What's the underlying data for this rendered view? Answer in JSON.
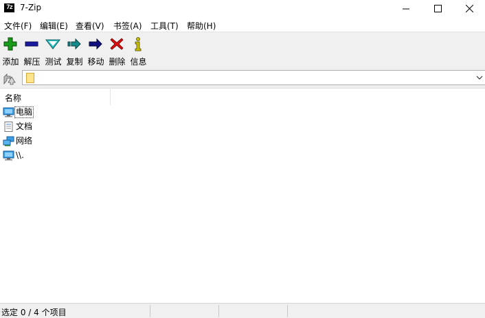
{
  "window": {
    "app_icon": "7z",
    "title": "7-Zip"
  },
  "menu": [
    "文件(F)",
    "编辑(E)",
    "查看(V)",
    "书签(A)",
    "工具(T)",
    "帮助(H)"
  ],
  "toolbar": [
    {
      "label": "添加",
      "icon": "add-icon"
    },
    {
      "label": "解压",
      "icon": "extract-icon"
    },
    {
      "label": "测试",
      "icon": "test-icon"
    },
    {
      "label": "复制",
      "icon": "copy-icon"
    },
    {
      "label": "移动",
      "icon": "move-icon"
    },
    {
      "label": "删除",
      "icon": "delete-icon"
    },
    {
      "label": "信息",
      "icon": "info-icon"
    }
  ],
  "address": {
    "value": ""
  },
  "list": {
    "columns": [
      "名称"
    ],
    "items": [
      {
        "name": "电脑",
        "icon": "computer-icon"
      },
      {
        "name": "文档",
        "icon": "document-icon"
      },
      {
        "name": "网络",
        "icon": "network-icon"
      },
      {
        "name": "\\\\.",
        "icon": "computer-icon"
      }
    ]
  },
  "status": {
    "text": "选定 0 / 4 个项目"
  },
  "colors": {
    "add": "#1a9a1a",
    "extract": "#1a1a9e",
    "test": "#2cc2c2",
    "copy": "#148a8a",
    "move": "#101080",
    "delete": "#d81010",
    "info": "#c8c000"
  }
}
